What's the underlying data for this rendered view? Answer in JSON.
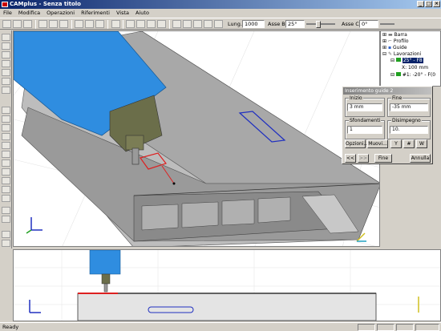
{
  "window": {
    "title": "CAMplus - Senza titolo"
  },
  "menu": [
    "File",
    "Modifica",
    "Operazioni",
    "Riferimenti",
    "Vista",
    "Aiuto"
  ],
  "toolbar": {
    "lung_label": "Lung.",
    "lung_value": "1000",
    "asse_b_label": "Asse B",
    "asse_b_value": "25°",
    "asse_c_label": "Asse C",
    "asse_c_value": "0°"
  },
  "tree": {
    "items": [
      {
        "label": "Barra"
      },
      {
        "label": "Profilo"
      },
      {
        "label": "Guide"
      },
      {
        "label": "Lavorazioni"
      },
      {
        "label": "25° - F8"
      },
      {
        "label": "X: 100 mm"
      },
      {
        "label": "#1: -20° - F(0"
      }
    ]
  },
  "dialog": {
    "title": "Inserimento guide 2",
    "inizio_label": "Inizio",
    "inizio_value": "3 mm",
    "fine_label": "Fine",
    "fine_value": "-35 mm",
    "sfondamenti_label": "Sfondamenti",
    "sfondamenti_value": "1",
    "disimpegno_label": "Disimpegno",
    "disimpegno_value": "10.",
    "opzioni_label": "Opzioni...",
    "muovi_label": "Muovi...",
    "btn_y": "Y",
    "btn_hash": "#",
    "btn_w": "W",
    "prev_label": "<<",
    "next_label": ">>",
    "fine_button": "Fine",
    "annulla_button": "Annulla"
  },
  "status": {
    "text": "Ready"
  },
  "colors": {
    "spindle": "#2f8de0",
    "profile": "#9a9a9a",
    "selection": "#dd2020",
    "slot": "#2030c0"
  }
}
